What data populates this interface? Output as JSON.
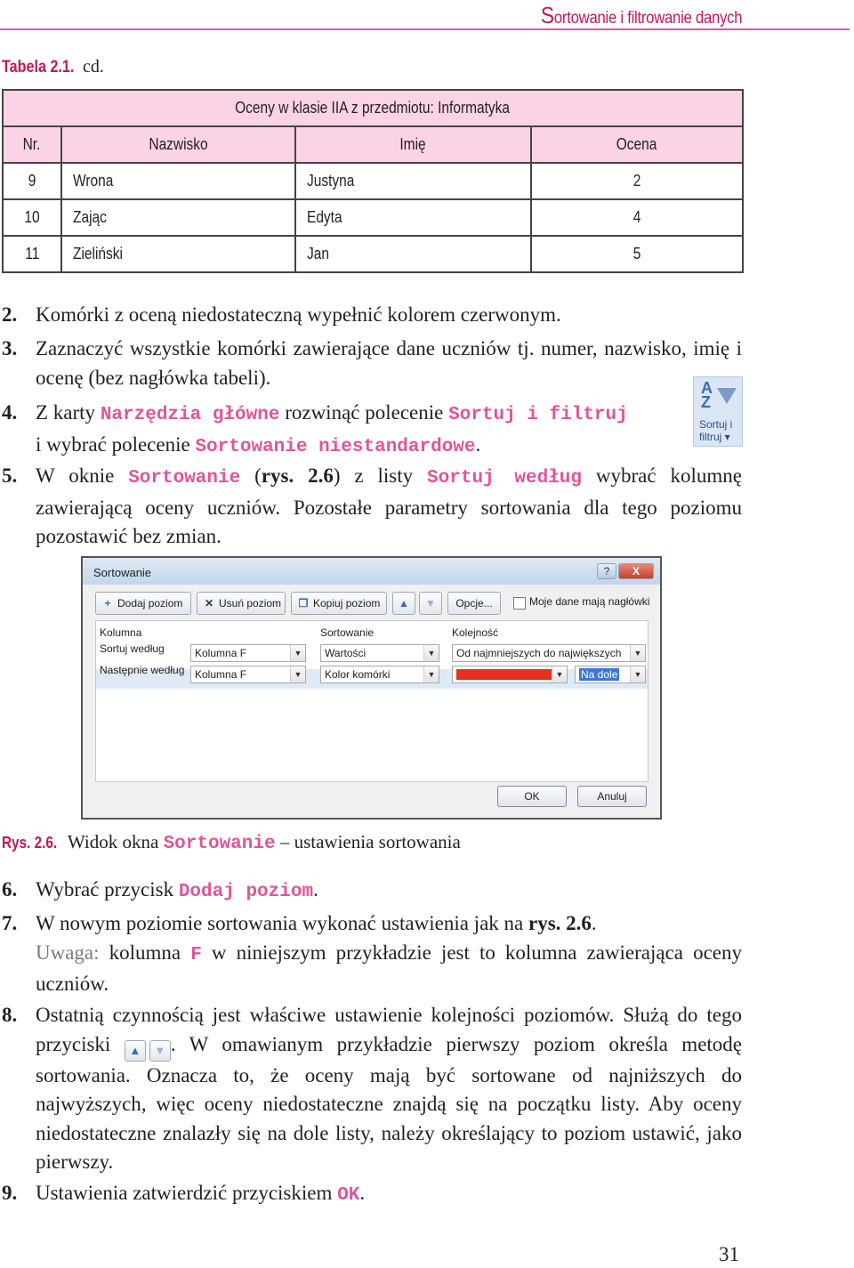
{
  "header": {
    "running_head_cap": "S",
    "running_head_rest": "ortowanie i filtrowanie danych"
  },
  "table_caption": {
    "label": "Tabela 2.1.",
    "suffix": "cd."
  },
  "grade_table": {
    "title": "Oceny w klasie IIA z przedmiotu: Informatyka",
    "columns": [
      "Nr.",
      "Nazwisko",
      "Imię",
      "Ocena"
    ],
    "rows": [
      [
        "9",
        "Wrona",
        "Justyna",
        "2"
      ],
      [
        "10",
        "Zając",
        "Edyta",
        "4"
      ],
      [
        "11",
        "Zieliński",
        "Jan",
        "5"
      ]
    ]
  },
  "steps": {
    "s2": {
      "num": "2.",
      "text": "Komórki z oceną niedostateczną wypełnić kolorem czerwonym."
    },
    "s3": {
      "num": "3.",
      "text": "Zaznaczyć wszystkie komórki zawierające dane uczniów tj. numer, nazwisko, imię i ocenę (bez nagłówka tabeli)."
    },
    "s4": {
      "num": "4.",
      "a": "Z karty ",
      "cmd1": "Narzędzia główne",
      "b": " rozwinąć polecenie ",
      "cmd2": "Sortuj i filtruj",
      "c": " i wybrać polecenie ",
      "cmd3": "Sortowanie niestandardowe",
      "d": "."
    },
    "s5": {
      "num": "5.",
      "a": "W oknie ",
      "cmd1": "Sortowanie",
      "b": " (",
      "ref": "rys. 2.6",
      "c": ") z listy ",
      "cmd2": "Sortuj według",
      "d": " wybrać kolumnę zawierającą oceny uczniów. Pozostałe parametry sortowania dla tego poziomu pozostawić bez zmian."
    },
    "s6": {
      "num": "6.",
      "a": "Wybrać przycisk ",
      "cmd1": "Dodaj poziom",
      "b": "."
    },
    "s7": {
      "num": "7.",
      "a": "W nowym poziomie sortowania wykonać ustawienia jak na ",
      "ref": "rys. 2.6",
      "b": ".",
      "note": "Uwaga:",
      "c": " kolumna ",
      "cmd1": "F",
      "d": " w niniejszym przykładzie jest to kolumna zawierająca oceny uczniów."
    },
    "s8": {
      "num": "8.",
      "a": "Ostatnią czynnością jest właściwe ustawienie kolejności poziomów. Służą do tego przyciski ",
      "b": ". W omawianym przykładzie pierwszy poziom określa metodę sortowania. Oznacza to, że oceny mają być sortowane od najniższych do najwyższych, więc oceny niedostateczne znajdą się na początku listy. Aby oceny niedostateczne znalazły się na dole listy, należy określający to poziom ustawić, jako pierwszy."
    },
    "s9": {
      "num": "9.",
      "a": "Ustawienia zatwierdzić przyciskiem ",
      "cmd1": "OK",
      "b": "."
    }
  },
  "ribbon_icon": {
    "line1": "Sortuj i",
    "line2": "filtruj",
    "icon": "sort-az-filter-icon"
  },
  "dialog": {
    "title": "Sortowanie",
    "help": "?",
    "close": "X",
    "toolbar": {
      "add_level": "Dodaj poziom",
      "delete_level": "Usuń poziom",
      "copy_level": "Kopiuj poziom",
      "options": "Opcje...",
      "headers_label": "Moje dane mają nagłówki"
    },
    "grid_headers": {
      "column": "Kolumna",
      "sort_on": "Sortowanie",
      "order": "Kolejność"
    },
    "rows": [
      {
        "label": "Sortuj według",
        "column": "Kolumna F",
        "sort_on": "Wartości",
        "order": "Od najmniejszych do największych"
      },
      {
        "label": "Następnie według",
        "column": "Kolumna F",
        "sort_on": "Kolor komórki",
        "order_color": "#e53020",
        "position": "Na dole"
      }
    ],
    "ok": "OK",
    "cancel": "Anuluj"
  },
  "fig_caption": {
    "label": "Rys. 2.6.",
    "a": " Widok okna ",
    "cmd1": "Sortowanie",
    "b": " – ustawienia sortowania"
  },
  "page_number": "31"
}
